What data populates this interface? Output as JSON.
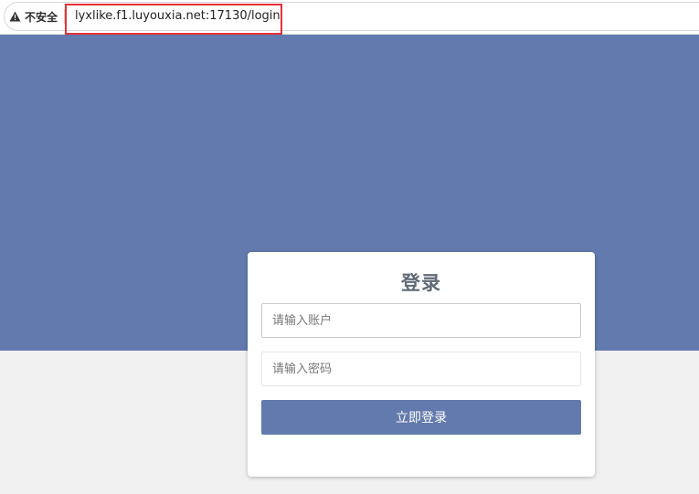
{
  "browser": {
    "security_label": "不安全",
    "url": "lyxlike.f1.luyouxia.net:17130/login",
    "highlight_color": "#e8303a"
  },
  "theme": {
    "primary": "#627aad",
    "page_background": "#f0f0f0"
  },
  "login": {
    "title": "登录",
    "account_placeholder": "请输入账户",
    "password_placeholder": "请输入密码",
    "submit_label": "立即登录"
  }
}
